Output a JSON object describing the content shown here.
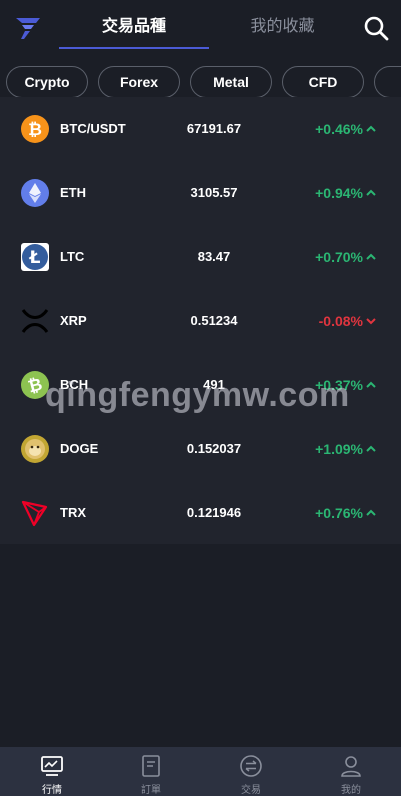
{
  "header": {
    "tabs": [
      {
        "label": "交易品種",
        "active": true
      },
      {
        "label": "我的收藏",
        "active": false
      }
    ],
    "search_icon": "search-icon",
    "logo_icon": "brand-logo-icon"
  },
  "categories": [
    {
      "label": "Crypto"
    },
    {
      "label": "Forex"
    },
    {
      "label": "Metal"
    },
    {
      "label": "CFD"
    },
    {
      "label": ""
    }
  ],
  "markets": [
    {
      "name": "BTC/USDT",
      "price": "67191.67",
      "change": "+0.46%",
      "direction": "up",
      "icon": "bitcoin-icon",
      "icon_color": "#f7931a"
    },
    {
      "name": "ETH",
      "price": "3105.57",
      "change": "+0.94%",
      "direction": "up",
      "icon": "ethereum-icon",
      "icon_color": "#627eea"
    },
    {
      "name": "LTC",
      "price": "83.47",
      "change": "+0.70%",
      "direction": "up",
      "icon": "litecoin-icon",
      "icon_color": "#345d9d"
    },
    {
      "name": "XRP",
      "price": "0.51234",
      "change": "-0.08%",
      "direction": "down",
      "icon": "xrp-icon",
      "icon_color": "#000000"
    },
    {
      "name": "BCH",
      "price": "491",
      "change": "+0.37%",
      "direction": "up",
      "icon": "bitcoin-cash-icon",
      "icon_color": "#8dc351"
    },
    {
      "name": "DOGE",
      "price": "0.152037",
      "change": "+1.09%",
      "direction": "up",
      "icon": "dogecoin-icon",
      "icon_color": "#c2a633"
    },
    {
      "name": "TRX",
      "price": "0.121946",
      "change": "+0.76%",
      "direction": "up",
      "icon": "tron-icon",
      "icon_color": "#ef0027"
    }
  ],
  "watermark": "qingfengymw.com",
  "bottom_nav": [
    {
      "label": "行情",
      "icon": "market-chart-icon",
      "active": true
    },
    {
      "label": "訂單",
      "icon": "order-document-icon",
      "active": false
    },
    {
      "label": "交易",
      "icon": "trade-exchange-icon",
      "active": false
    },
    {
      "label": "我的",
      "icon": "profile-user-icon",
      "active": false
    }
  ],
  "colors": {
    "background": "#1b1e26",
    "list_background": "#21242d",
    "accent": "#4b5bd6",
    "up": "#2bb673",
    "down": "#e0353f",
    "nav_background": "#2c3140"
  }
}
